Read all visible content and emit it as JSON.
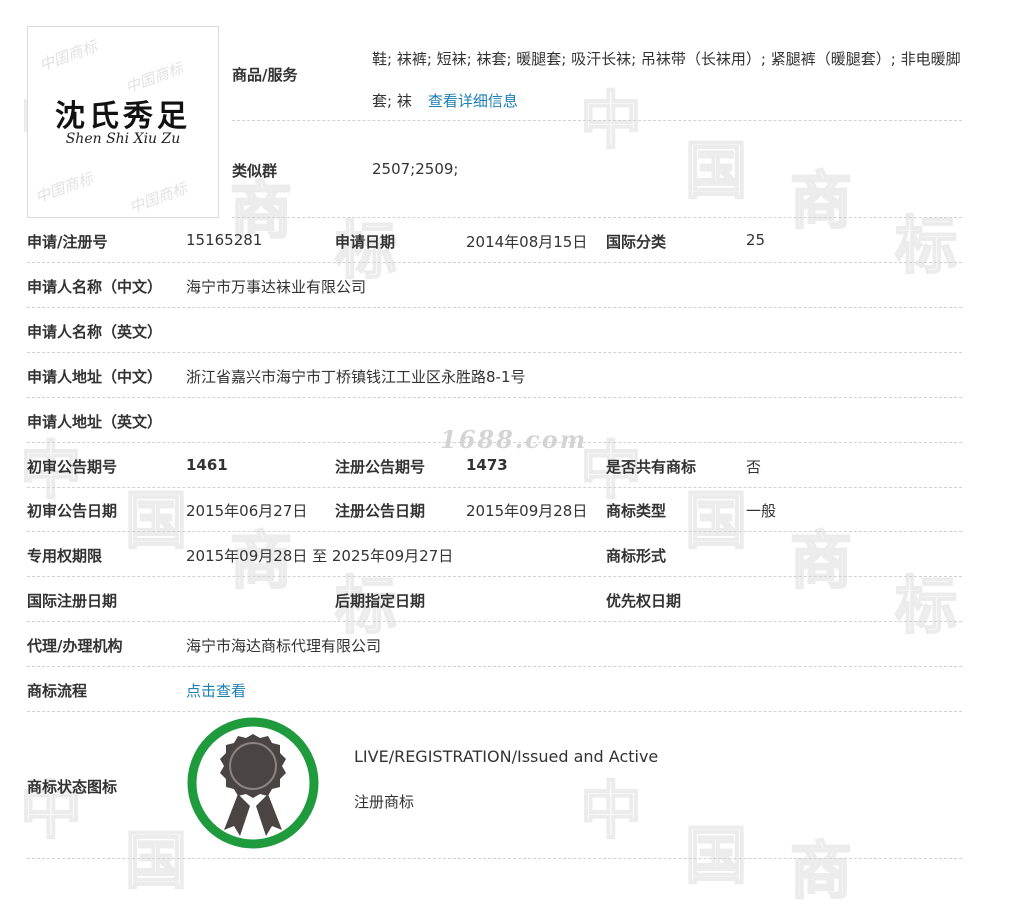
{
  "watermark": {
    "chars": [
      "中",
      "国",
      "商",
      "标"
    ],
    "site": "1688.com"
  },
  "logo": {
    "main_text": "沈氏秀足",
    "sub_text": "Shen Shi Xiu Zu",
    "watermark_text": "中国商标"
  },
  "top": {
    "goods_label": "商品/服务",
    "goods_value": "鞋; 袜裤; 短袜; 袜套; 暖腿套; 吸汗长袜; 吊袜带（长袜用）; 紧腿裤（暖腿套）; 非电暖脚套; 袜",
    "goods_link": "查看详细信息",
    "similar_label": "类似群",
    "similar_value": "2507;2509;"
  },
  "rows": {
    "reg_no_label": "申请/注册号",
    "reg_no": "15165281",
    "apply_date_label": "申请日期",
    "apply_date": "2014年08月15日",
    "intl_class_label": "国际分类",
    "intl_class": "25",
    "applicant_cn_label": "申请人名称（中文）",
    "applicant_cn": "海宁市万事达袜业有限公司",
    "applicant_en_label": "申请人名称（英文）",
    "address_cn_label": "申请人地址（中文）",
    "address_cn": "浙江省嘉兴市海宁市丁桥镇钱江工业区永胜路8-1号",
    "address_en_label": "申请人地址（英文）",
    "prelim_no_label": "初审公告期号",
    "prelim_no": "1461",
    "reg_pub_no_label": "注册公告期号",
    "reg_pub_no": "1473",
    "shared_label": "是否共有商标",
    "shared": "否",
    "prelim_date_label": "初审公告日期",
    "prelim_date": "2015年06月27日",
    "reg_pub_date_label": "注册公告日期",
    "reg_pub_date": "2015年09月28日",
    "tm_type_label": "商标类型",
    "tm_type": "一般",
    "exclusive_label": "专用权期限",
    "exclusive": "2015年09月28日 至 2025年09月27日",
    "tm_form_label": "商标形式",
    "intl_reg_date_label": "国际注册日期",
    "later_designation_label": "后期指定日期",
    "priority_date_label": "优先权日期",
    "agent_label": "代理/办理机构",
    "agent": "海宁市海达商标代理有限公司",
    "process_label": "商标流程",
    "process_link": "点击查看",
    "status_icon_label": "商标状态图标",
    "status_en": "LIVE/REGISTRATION/Issued and Active",
    "status_cn": "注册商标"
  },
  "colors": {
    "link": "#1a7fb3",
    "badge_ring": "#1f9a3c",
    "badge_icon": "#4a4442"
  },
  "icons": {
    "status_badge": "award-ribbon-icon"
  }
}
